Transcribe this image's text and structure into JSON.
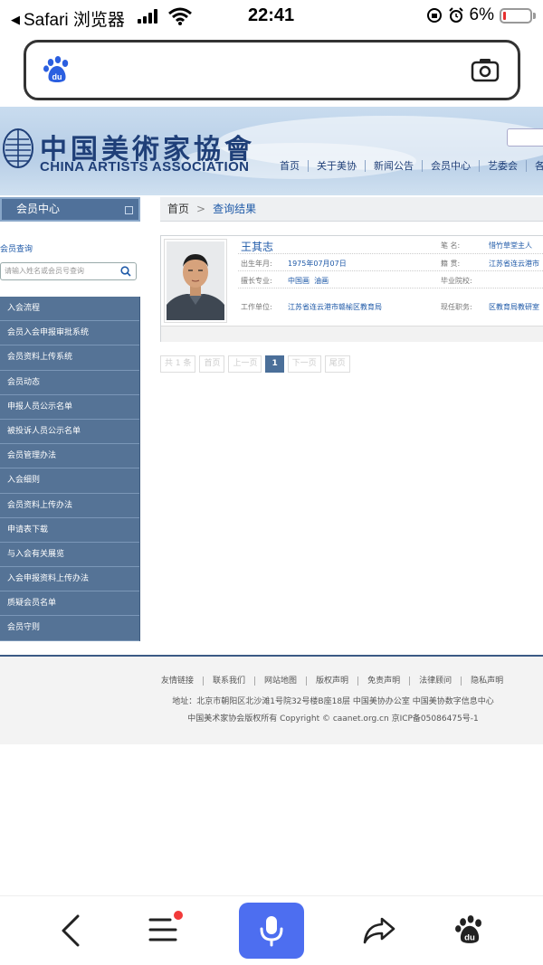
{
  "status_bar": {
    "back_app": "Safari 浏览器",
    "time": "22:41",
    "battery": "6%"
  },
  "browser": {
    "logo_icon": "baidu-paw-icon",
    "camera_icon": "camera-icon"
  },
  "site": {
    "logo_cn": "中国美術家協會",
    "logo_en": "CHINA ARTISTS ASSOCIATION",
    "nav": [
      "首页",
      "关于美协",
      "新闻公告",
      "会员中心",
      "艺委会",
      "各"
    ],
    "sidebar": {
      "title": "会员中心",
      "query_label": "会员查询",
      "query_placeholder": "请输入姓名或会员号查询",
      "menu": [
        "入会流程",
        "会员入会申报审批系统",
        "会员资料上传系统",
        "会员动态",
        "申报人员公示名单",
        "被投诉人员公示名单",
        "会员管理办法",
        "入会细则",
        "会员资料上传办法",
        "申请表下载",
        "与入会有关展览",
        "入会申报资料上传办法",
        "质疑会员名单",
        "会员守则"
      ]
    },
    "breadcrumb": {
      "home": "首页",
      "separator": ">",
      "current": "查询结果"
    },
    "result": {
      "name": "王其志",
      "pen_name_label": "笔    名:",
      "pen_name": "惜竹草堂主人",
      "birth_label": "出生年月:",
      "birth": "1975年07月07日",
      "native_label": "籍    贯:",
      "native": "江苏省连云港市",
      "specialty_label": "擅长专业:",
      "specialty": "中国画  油画",
      "school_label": "毕业院校:",
      "school": "",
      "work_label": "工作单位:",
      "work": "江苏省连云港市赣榆区教育局",
      "position_label": "现任职务:",
      "position": "区教育局教研室"
    },
    "pager": {
      "total": "共 1 条",
      "first": "首页",
      "prev": "上一页",
      "current": "1",
      "next": "下一页",
      "last": "尾页"
    },
    "footer": {
      "links": [
        "友情链接",
        "联系我们",
        "网站地图",
        "版权声明",
        "免责声明",
        "法律顾问",
        "隐私声明"
      ],
      "address": "地址：北京市朝阳区北沙滩1号院32号楼B座18层 中国美协办公室 中国美协数字信息中心",
      "copyright": "中国美术家协会版权所有 Copyright © caanet.org.cn 京ICP备05086475号-1"
    }
  },
  "toolbar": {
    "items": [
      "back-icon",
      "menu-icon",
      "voice-icon",
      "share-icon",
      "baidu-paw-icon"
    ],
    "voice_color": "#4d6ef0",
    "notify_color": "#f23a3a"
  }
}
